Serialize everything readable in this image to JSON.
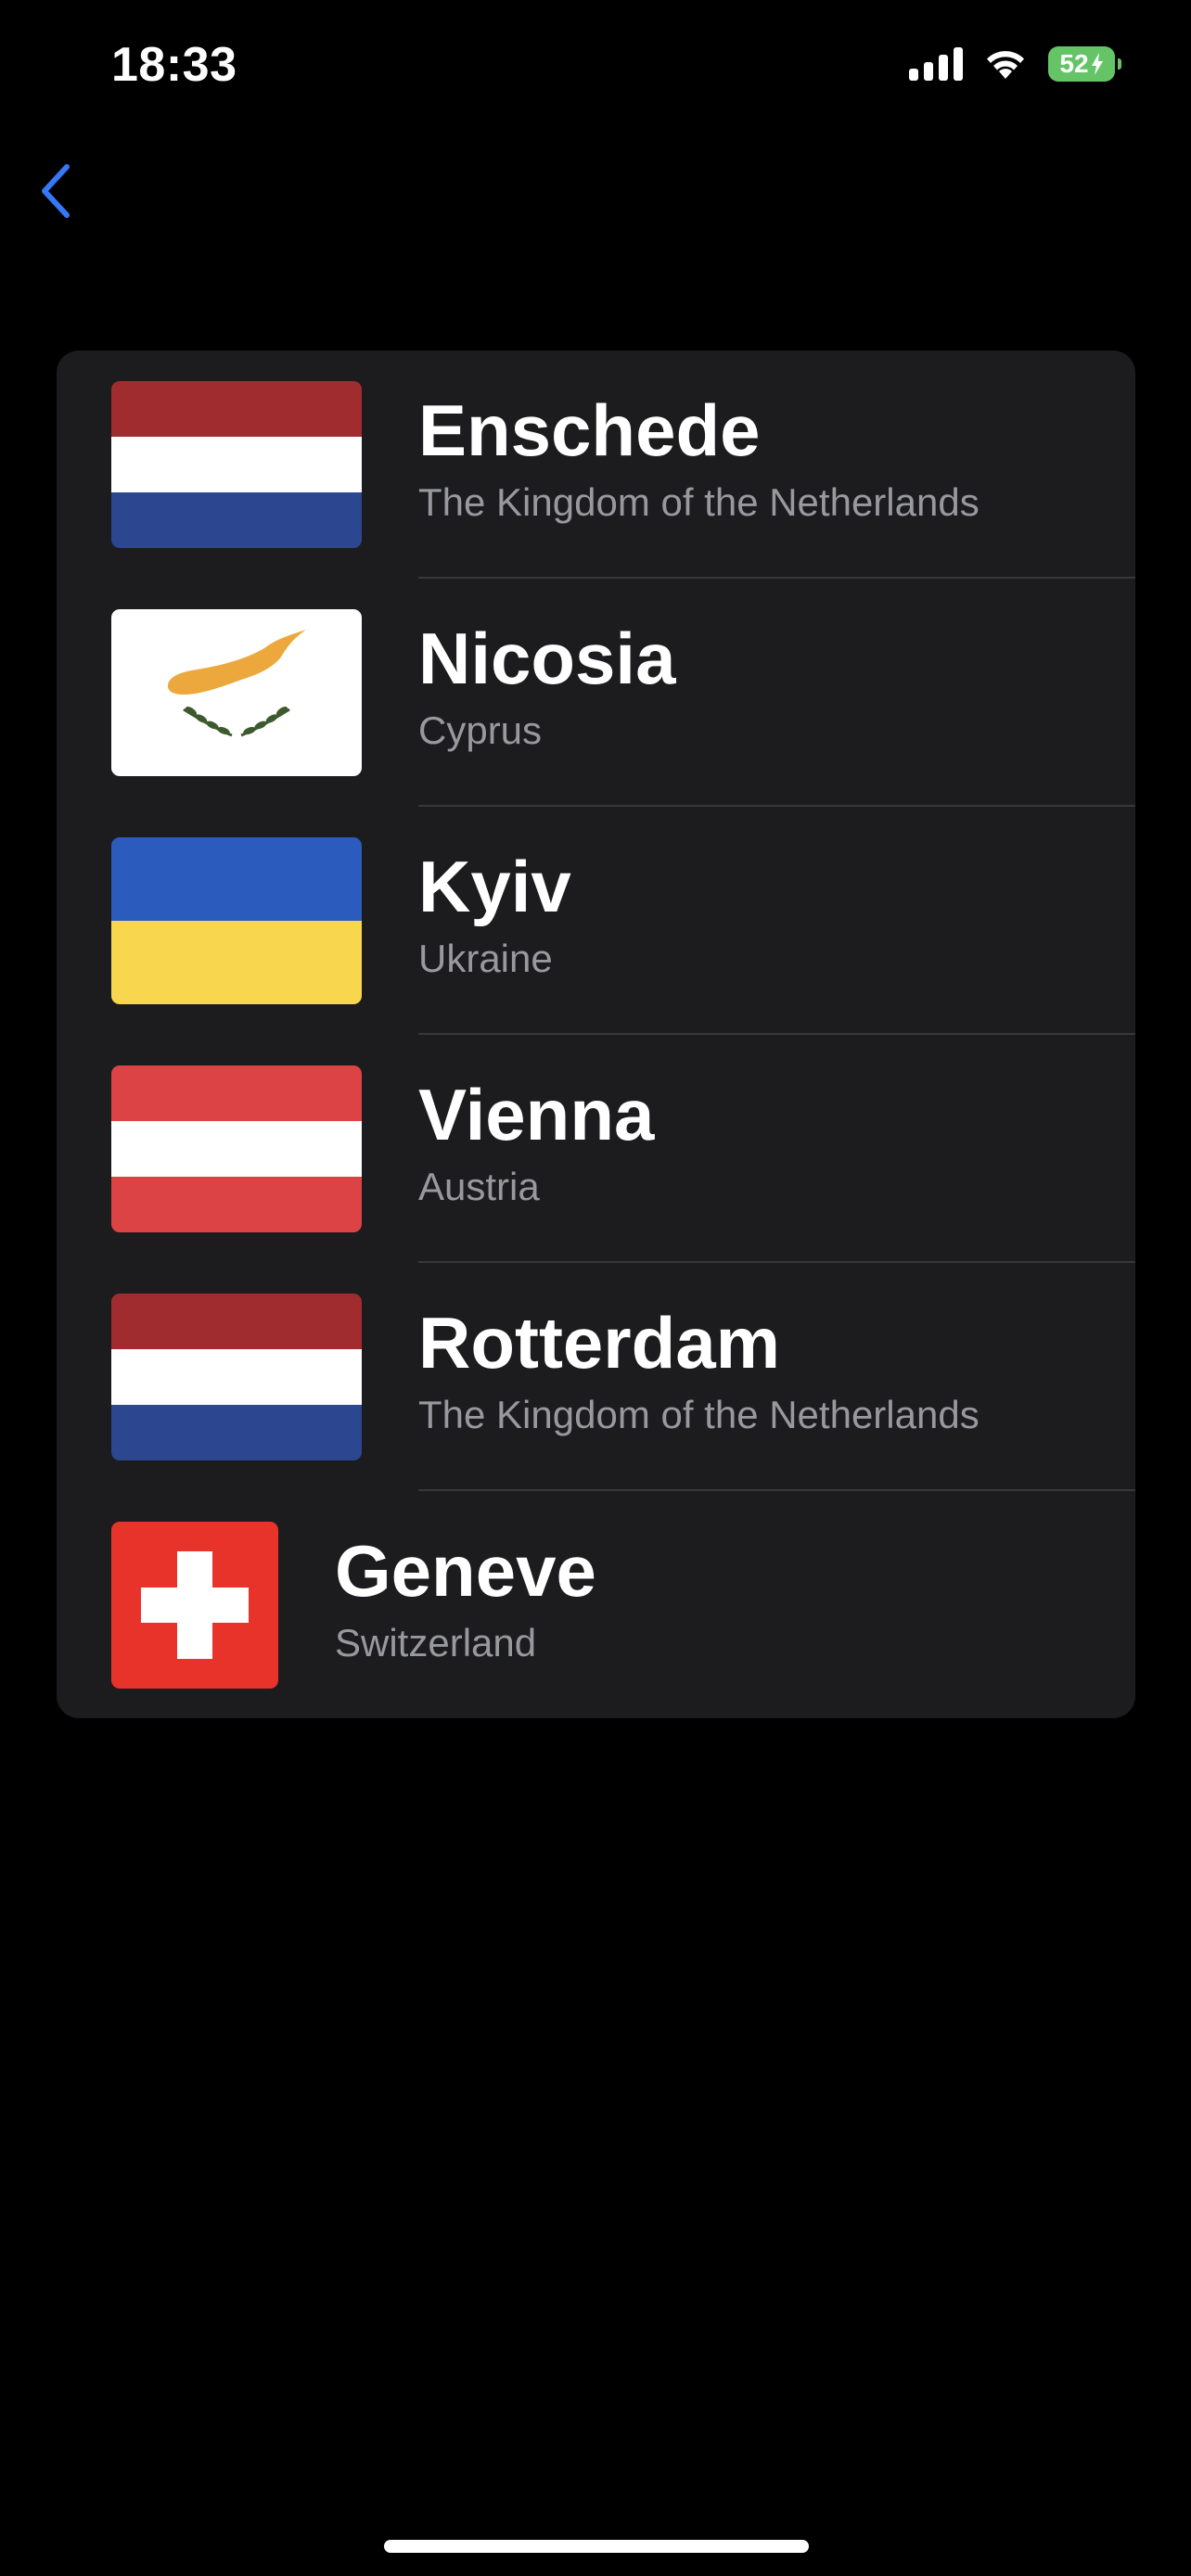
{
  "status_bar": {
    "time": "18:33",
    "battery_level": "52",
    "battery_color": "#65c466"
  },
  "nav": {
    "back_icon": "chevron-left-icon",
    "accent_color": "#3478f6"
  },
  "cities": [
    {
      "city": "Enschede",
      "country": "The Kingdom of the Netherlands",
      "flag": "netherlands-flag-icon"
    },
    {
      "city": "Nicosia",
      "country": "Cyprus",
      "flag": "cyprus-flag-icon"
    },
    {
      "city": "Kyiv",
      "country": "Ukraine",
      "flag": "ukraine-flag-icon"
    },
    {
      "city": "Vienna",
      "country": "Austria",
      "flag": "austria-flag-icon"
    },
    {
      "city": "Rotterdam",
      "country": "The Kingdom of the Netherlands",
      "flag": "netherlands-flag-icon"
    },
    {
      "city": "Geneve",
      "country": "Switzerland",
      "flag": "switzerland-flag-icon"
    }
  ],
  "colors": {
    "background": "#000000",
    "card": "#1c1c1e",
    "secondary_text": "#98989f",
    "separator": "#38383a"
  }
}
